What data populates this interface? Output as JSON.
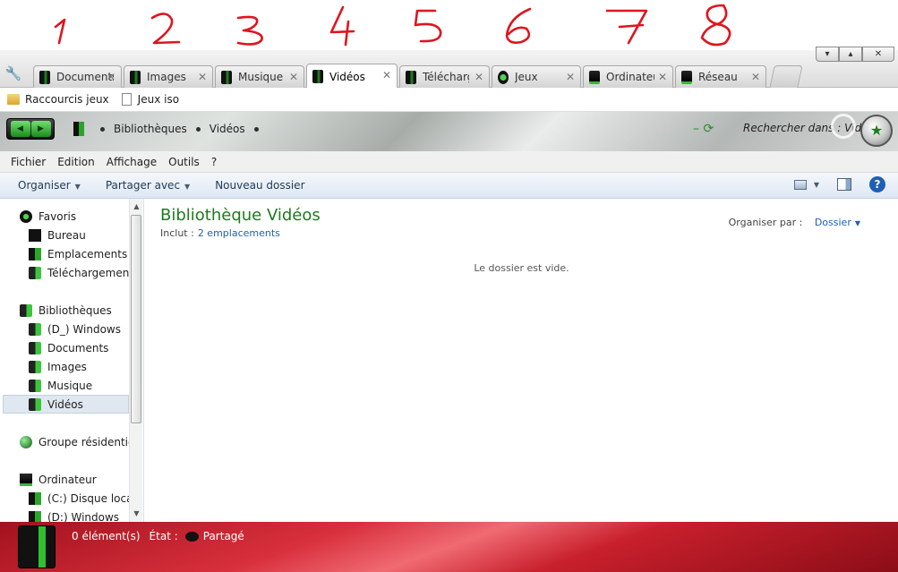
{
  "annotations": [
    "1",
    "2",
    "3",
    "4",
    "5",
    "6",
    "7",
    "8"
  ],
  "tabs": [
    {
      "label": "Documents",
      "active": false
    },
    {
      "label": "Images",
      "active": false
    },
    {
      "label": "Musique",
      "active": false
    },
    {
      "label": "Vidéos",
      "active": true
    },
    {
      "label": "Téléchargements",
      "active": false
    },
    {
      "label": "Jeux",
      "active": false
    },
    {
      "label": "Ordinateur",
      "active": false
    },
    {
      "label": "Réseau",
      "active": false
    }
  ],
  "window": {
    "minimize": "▾",
    "maximize": "▴",
    "close": "✕"
  },
  "shortcuts": [
    {
      "label": "Raccourcis jeux",
      "icon": "folder-icon"
    },
    {
      "label": "Jeux iso",
      "icon": "file-icon"
    }
  ],
  "breadcrumb": {
    "items": [
      "Bibliothèques",
      "Vidéos"
    ]
  },
  "search": {
    "placeholder": "Rechercher dans : Vidéos"
  },
  "menu": [
    "Fichier",
    "Edition",
    "Affichage",
    "Outils",
    "?"
  ],
  "commands": {
    "organize": "Organiser",
    "share": "Partager avec",
    "new_folder": "Nouveau dossier"
  },
  "sidebar": {
    "favorites": {
      "label": "Favoris",
      "items": [
        "Bureau",
        "Emplacements récents",
        "Téléchargements"
      ]
    },
    "libraries": {
      "label": "Bibliothèques",
      "items": [
        "(D_) Windows",
        "Documents",
        "Images",
        "Musique",
        "Vidéos"
      ]
    },
    "homegroup": {
      "label": "Groupe résidentiel"
    },
    "computer": {
      "label": "Ordinateur",
      "items": [
        "(C:) Disque local",
        "(D:) Windows"
      ]
    }
  },
  "content": {
    "title": "Bibliothèque Vidéos",
    "include_label": "Inclut :",
    "include_link": "2 emplacements",
    "arrange_label": "Organiser par :",
    "arrange_value": "Dossier",
    "empty_message": "Le dossier est vide."
  },
  "status": {
    "count": "0 élément(s)",
    "state_label": "État :",
    "state_value": "Partagé"
  },
  "colors": {
    "accent_green": "#1f7a1f",
    "link_blue": "#1f5fb3",
    "status_red": "#c8202c"
  }
}
